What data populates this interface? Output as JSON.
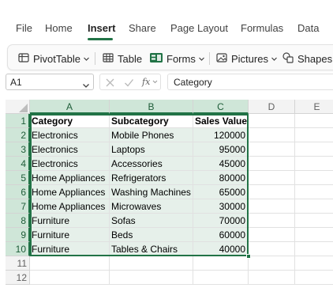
{
  "menu": {
    "tabs": [
      {
        "label": "File"
      },
      {
        "label": "Home"
      },
      {
        "label": "Insert"
      },
      {
        "label": "Share"
      },
      {
        "label": "Page Layout"
      },
      {
        "label": "Formulas"
      },
      {
        "label": "Data"
      }
    ],
    "active_tab": "Insert"
  },
  "ribbon": {
    "pivottable_label": "PivotTable",
    "pivottable_icon": "pivottable-icon",
    "table_label": "Table",
    "table_icon": "table-icon",
    "forms_label": "Forms",
    "forms_icon": "forms-icon",
    "pictures_label": "Pictures",
    "pictures_icon": "pictures-icon",
    "shapes_label": "Shapes",
    "shapes_icon": "shapes-icon"
  },
  "formula_bar": {
    "name_box": "A1",
    "formula": "Category",
    "cancel_icon": "close-icon",
    "enter_icon": "checkmark-icon",
    "function_icon": "fx-icon"
  },
  "grid": {
    "columns": [
      "A",
      "B",
      "C",
      "D",
      "E"
    ],
    "rows": [
      "1",
      "2",
      "3",
      "4",
      "5",
      "6",
      "7",
      "8",
      "9",
      "10",
      "11",
      "12"
    ],
    "cells": [
      [
        "Category",
        "Subcategory",
        "Sales Value"
      ],
      [
        "Electronics",
        "Mobile Phones",
        "120000"
      ],
      [
        "Electronics",
        "Laptops",
        "95000"
      ],
      [
        "Electronics",
        "Accessories",
        "45000"
      ],
      [
        "Home Appliances",
        "Refrigerators",
        "80000"
      ],
      [
        "Home Appliances",
        "Washing Machines",
        "65000"
      ],
      [
        "Home Appliances",
        "Microwaves",
        "30000"
      ],
      [
        "Furniture",
        "Sofas",
        "70000"
      ],
      [
        "Furniture",
        "Beds",
        "60000"
      ],
      [
        "Furniture",
        "Tables & Chairs",
        "40000"
      ]
    ]
  },
  "colors": {
    "accent": "#217346",
    "selection_fill": "#e6f0ea",
    "header_selected": "#cfe6d8"
  }
}
